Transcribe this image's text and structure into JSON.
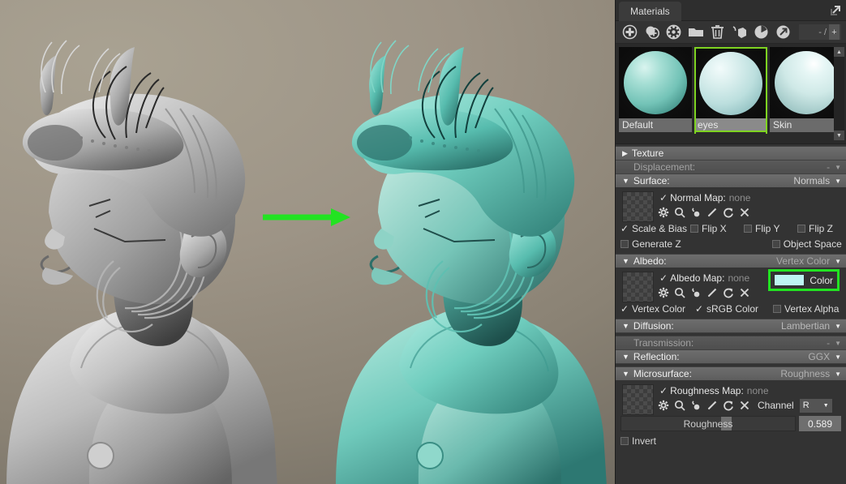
{
  "panel": {
    "tab": "Materials",
    "popout_icon": "popout-icon",
    "toolbar": {
      "icons": [
        {
          "name": "add-material-icon",
          "label": "Add Material"
        },
        {
          "name": "duplicate-material-icon",
          "label": "Duplicate Material"
        },
        {
          "name": "material-options-icon",
          "label": "Material Options"
        },
        {
          "name": "folder-icon",
          "label": "Open Folder"
        },
        {
          "name": "trash-icon",
          "label": "Delete"
        },
        {
          "name": "assign-cube-icon",
          "label": "Assign To Mesh"
        },
        {
          "name": "pie-icon",
          "label": "Coverage"
        },
        {
          "name": "arrow-circle-icon",
          "label": "Export"
        }
      ],
      "page_value": "- /",
      "page_plus": "+"
    },
    "materials": [
      {
        "name": "Default",
        "selected": false
      },
      {
        "name": "eyes",
        "selected": true
      },
      {
        "name": "Skin",
        "selected": false
      }
    ],
    "scroll_up": "▲",
    "scroll_down": "▼"
  },
  "sections": {
    "texture": {
      "title": "Texture",
      "tri": "▶",
      "value": "",
      "caret": ""
    },
    "displacement": {
      "title": "Displacement:",
      "value": "-",
      "caret": "▼"
    },
    "surface": {
      "title": "Surface:",
      "tri": "▼",
      "value": "Normals",
      "caret": "▼"
    },
    "albedo": {
      "title": "Albedo:",
      "tri": "▼",
      "value": "Vertex Color",
      "caret": "▼"
    },
    "diffusion": {
      "title": "Diffusion:",
      "tri": "▼",
      "value": "Lambertian",
      "caret": "▼"
    },
    "transmission": {
      "title": "Transmission:",
      "value": "-",
      "caret": "▼"
    },
    "reflection": {
      "title": "Reflection:",
      "tri": "▼",
      "value": "GGX",
      "caret": "▼"
    },
    "microsurface": {
      "title": "Microsurface:",
      "tri": "▼",
      "value": "Roughness",
      "caret": "▼"
    }
  },
  "normal_map": {
    "checked": "✓",
    "label": "Normal Map:",
    "value": "none",
    "icons": [
      "gear-icon",
      "magnifier-icon",
      "eyedropper-icon",
      "pencil-icon",
      "reload-icon",
      "close-icon"
    ],
    "checkboxes": [
      {
        "label": "Scale & Bias",
        "checked": true
      },
      {
        "label": "Flip X",
        "checked": false
      },
      {
        "label": "Flip Y",
        "checked": false
      },
      {
        "label": "Flip Z",
        "checked": false
      },
      {
        "label": "Generate Z",
        "checked": false
      },
      {
        "label": "Object Space",
        "checked": false
      }
    ]
  },
  "albedo_map": {
    "checked": "✓",
    "label": "Albedo Map:",
    "value": "none",
    "icons": [
      "gear-icon",
      "magnifier-icon",
      "eyedropper-icon",
      "pencil-icon",
      "reload-icon",
      "close-icon"
    ],
    "color_label": "Color",
    "color_value": "#bdf5f2",
    "highlight_color": "#22e322",
    "checkboxes": [
      {
        "label": "Vertex Color",
        "checked": true
      },
      {
        "label": "sRGB Color",
        "checked": true
      },
      {
        "label": "Vertex Alpha",
        "checked": false
      }
    ]
  },
  "roughness_map": {
    "checked": "✓",
    "label": "Roughness Map:",
    "value": "none",
    "icons": [
      "gear-icon",
      "magnifier-icon",
      "eyedropper-icon",
      "pencil-icon",
      "reload-icon",
      "close-icon"
    ],
    "channel_label": "Channel",
    "channel_value": "R",
    "channel_caret": "▼",
    "slider_label": "Roughness",
    "slider_value": "0.589",
    "invert_label": "Invert",
    "invert_checked": false
  },
  "viewport": {
    "left_render_name": "grey-clay-sculpt-render",
    "right_render_name": "teal-material-sculpt-render",
    "arrow_name": "green-transition-arrow",
    "arrow_color": "#22e322",
    "background_top": "#a9a292",
    "background_bottom": "#6f6a60"
  }
}
